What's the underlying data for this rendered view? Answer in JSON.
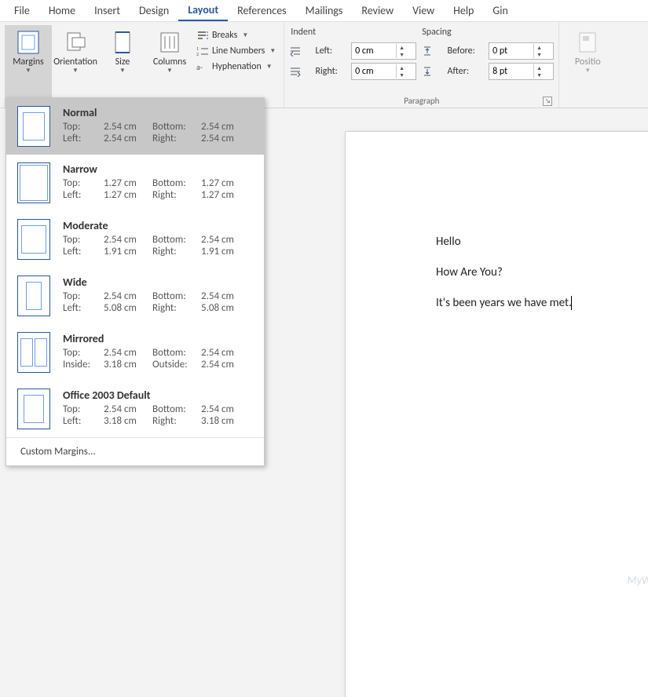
{
  "tabs": [
    "File",
    "Home",
    "Insert",
    "Design",
    "Layout",
    "References",
    "Mailings",
    "Review",
    "View",
    "Help",
    "Gin"
  ],
  "active_tab": "Layout",
  "ribbon": {
    "page_setup": {
      "margins": "Margins",
      "orientation": "Orientation",
      "size": "Size",
      "columns": "Columns",
      "breaks": "Breaks",
      "line_numbers": "Line Numbers",
      "hyphenation": "Hyphenation"
    },
    "paragraph": {
      "title": "Paragraph",
      "indent_label": "Indent",
      "spacing_label": "Spacing",
      "left_label": "Left:",
      "right_label": "Right:",
      "before_label": "Before:",
      "after_label": "After:",
      "left_value": "0 cm",
      "right_value": "0 cm",
      "before_value": "0 pt",
      "after_value": "8 pt"
    },
    "arrange": {
      "position": "Positio"
    }
  },
  "margins_menu": {
    "presets": [
      {
        "name": "Normal",
        "l1a": "Top:",
        "l1b": "2.54 cm",
        "l1c": "Bottom:",
        "l1d": "2.54 cm",
        "l2a": "Left:",
        "l2b": "2.54 cm",
        "l2c": "Right:",
        "l2d": "2.54 cm",
        "selected": true,
        "thumb": "normal"
      },
      {
        "name": "Narrow",
        "l1a": "Top:",
        "l1b": "1.27 cm",
        "l1c": "Bottom:",
        "l1d": "1.27 cm",
        "l2a": "Left:",
        "l2b": "1.27 cm",
        "l2c": "Right:",
        "l2d": "1.27 cm",
        "selected": false,
        "thumb": "narrow"
      },
      {
        "name": "Moderate",
        "l1a": "Top:",
        "l1b": "2.54 cm",
        "l1c": "Bottom:",
        "l1d": "2.54 cm",
        "l2a": "Left:",
        "l2b": "1.91 cm",
        "l2c": "Right:",
        "l2d": "1.91 cm",
        "selected": false,
        "thumb": "moderate"
      },
      {
        "name": "Wide",
        "l1a": "Top:",
        "l1b": "2.54 cm",
        "l1c": "Bottom:",
        "l1d": "2.54 cm",
        "l2a": "Left:",
        "l2b": "5.08 cm",
        "l2c": "Right:",
        "l2d": "5.08 cm",
        "selected": false,
        "thumb": "wide"
      },
      {
        "name": "Mirrored",
        "l1a": "Top:",
        "l1b": "2.54 cm",
        "l1c": "Bottom:",
        "l1d": "2.54 cm",
        "l2a": "Inside:",
        "l2b": "3.18 cm",
        "l2c": "Outside:",
        "l2d": "2.54 cm",
        "selected": false,
        "thumb": "mirrored"
      },
      {
        "name": "Office 2003 Default",
        "l1a": "Top:",
        "l1b": "2.54 cm",
        "l1c": "Bottom:",
        "l1d": "2.54 cm",
        "l2a": "Left:",
        "l2b": "3.18 cm",
        "l2c": "Right:",
        "l2d": "3.18 cm",
        "selected": false,
        "thumb": "o2003"
      }
    ],
    "custom": "Custom Margins..."
  },
  "document": {
    "lines": [
      "Hello",
      "How Are You?",
      "It's been years we have met."
    ]
  },
  "watermark": {
    "text": "MyWindowsHub.com",
    "m": "M",
    "w": "W"
  }
}
